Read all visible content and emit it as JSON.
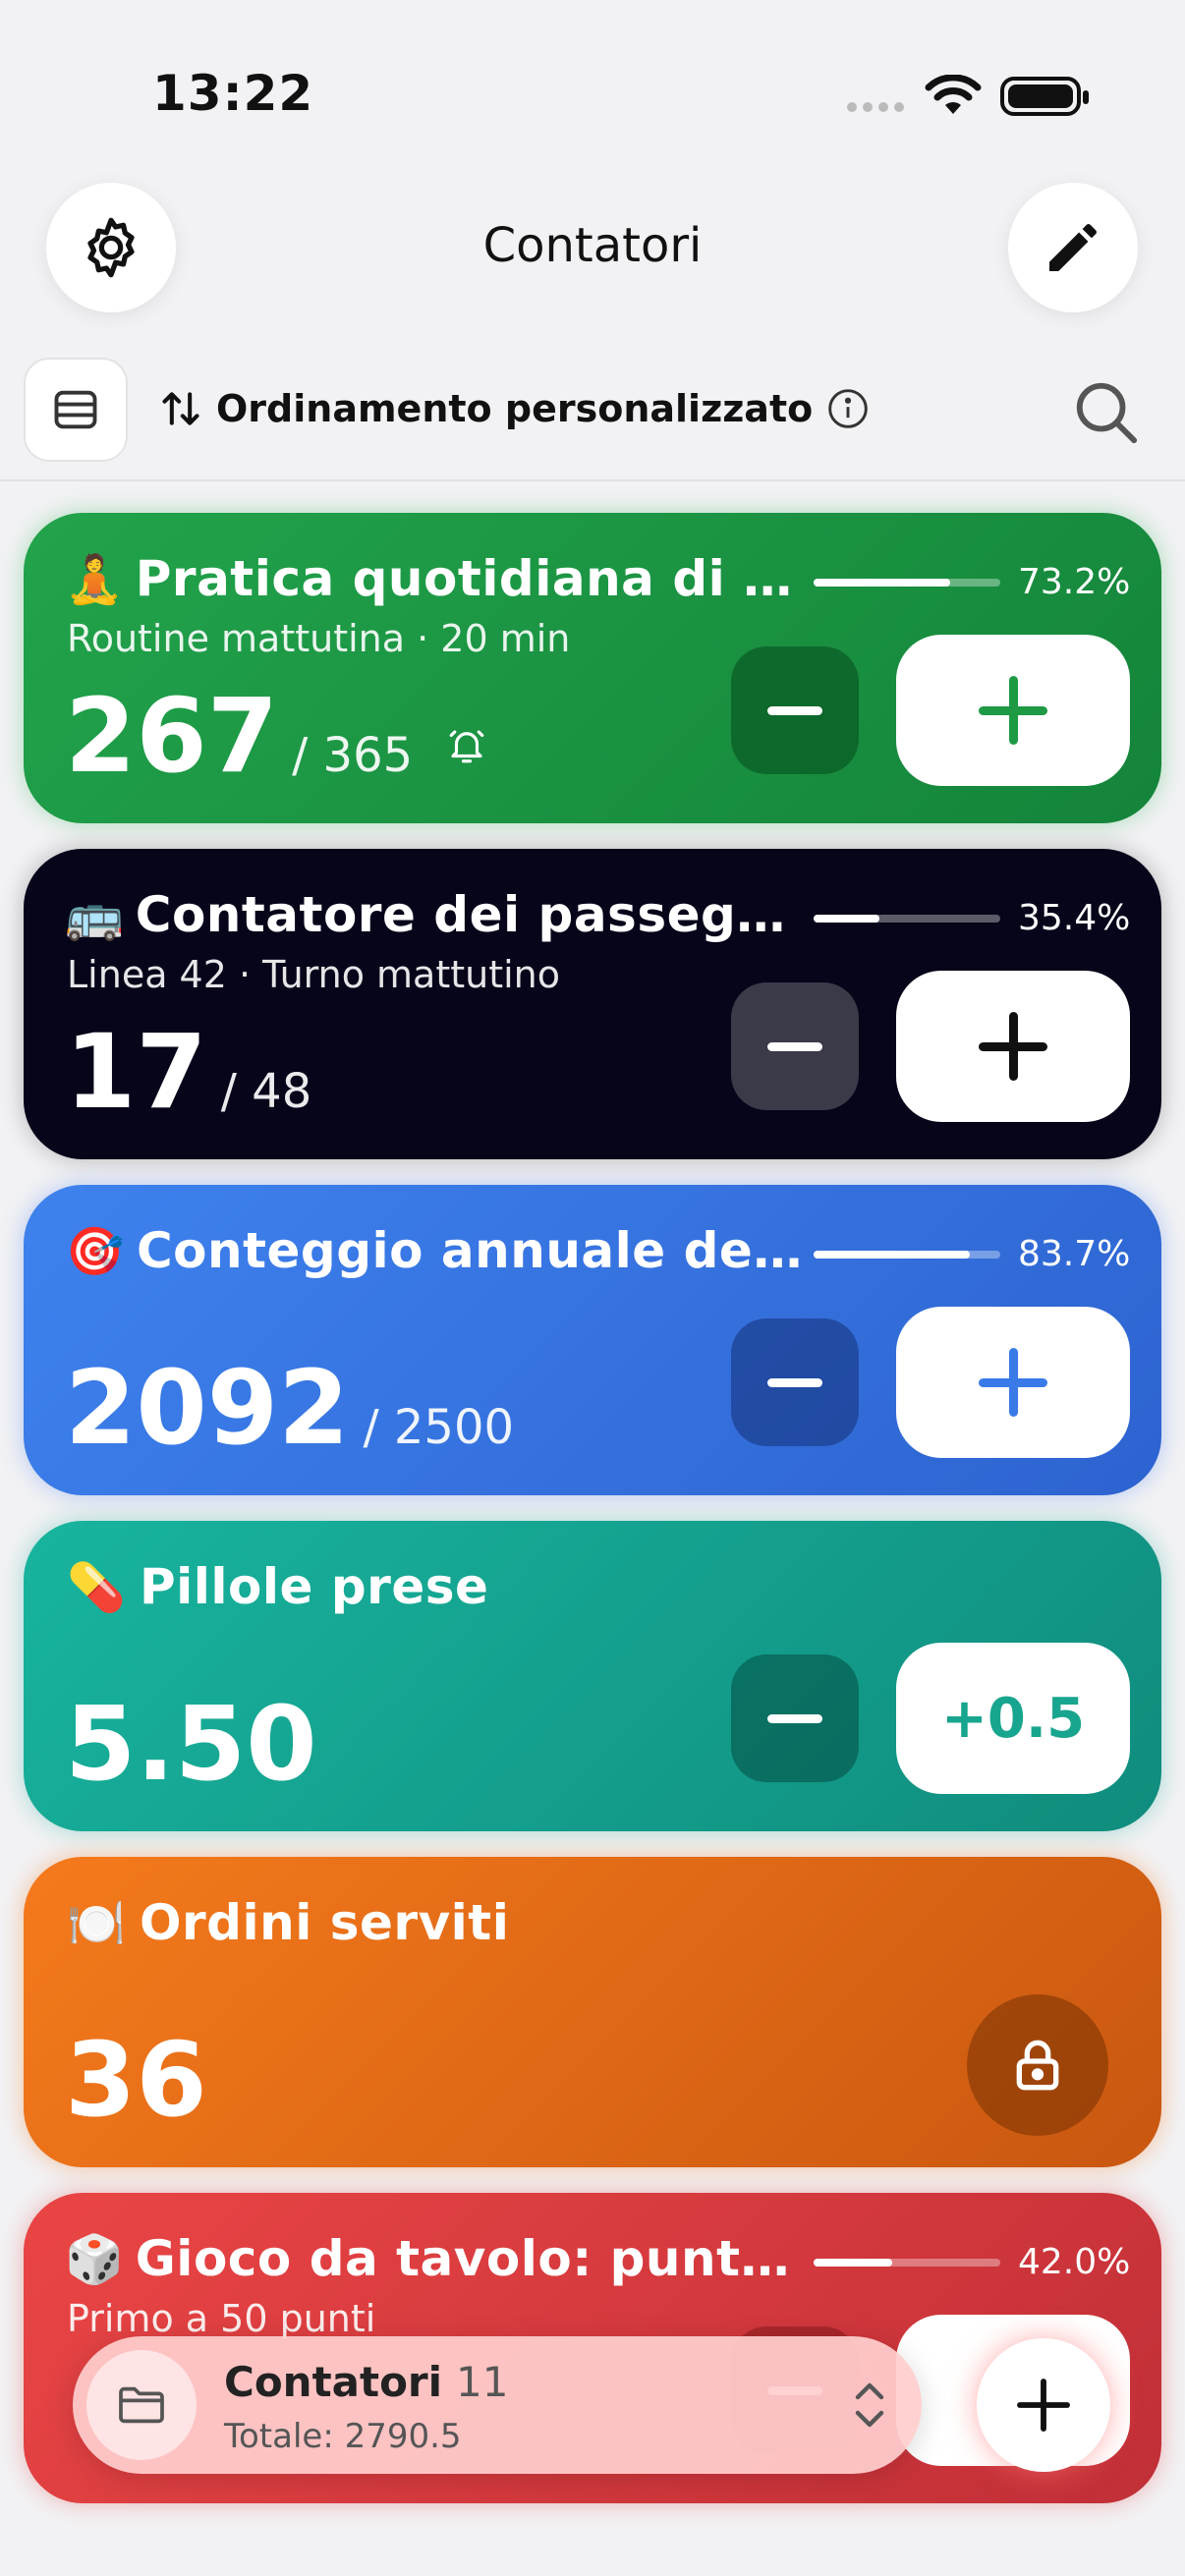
{
  "status_bar": {
    "time": "13:22"
  },
  "header": {
    "title": "Contatori",
    "settings_icon": "gear-icon",
    "edit_icon": "pencil-icon"
  },
  "toolbar": {
    "sort_label": "Ordinamento personalizzato",
    "sort_icon": "sort-arrows-icon",
    "info_icon": "info-icon",
    "search_icon": "search-icon",
    "list_icon": "list-icon"
  },
  "counters": [
    {
      "emoji": "🧘",
      "title": "Pratica quotidiana di yoga",
      "subtitle": "Routine mattutina · 20 min",
      "count": "267",
      "goal": "/ 365",
      "progress": 0.732,
      "progress_label": "73.2%",
      "has_reminder": true,
      "color": "#1e9a44"
    },
    {
      "emoji": "🚌",
      "title": "Contatore dei passegge...",
      "subtitle": "Linea 42 · Turno mattutino",
      "count": "17",
      "goal": "/ 48",
      "progress": 0.354,
      "progress_label": "35.4%",
      "color": "#06051a"
    },
    {
      "emoji": "🎯",
      "title": "Conteggio annuale dell...",
      "subtitle": "",
      "count": "2092",
      "goal": "/ 2500",
      "progress": 0.837,
      "progress_label": "83.7%",
      "color": "#3a7ae8"
    },
    {
      "emoji": "💊",
      "title": "Pillole prese",
      "count": "5.50",
      "step_label": "+0.5",
      "color": "#15a592"
    },
    {
      "emoji": "🍽️",
      "title": "Ordini serviti",
      "count": "36",
      "locked": true,
      "color": "#ee7218"
    },
    {
      "emoji": "🎲",
      "title": "Gioco da tavolo: punteg...",
      "subtitle": "Primo a 50 punti",
      "progress": 0.42,
      "progress_label": "42.0%",
      "color": "#e04040"
    }
  ],
  "bottom_bar": {
    "title": "Contatori",
    "count": "11",
    "total": "Totale: 2790.5"
  }
}
